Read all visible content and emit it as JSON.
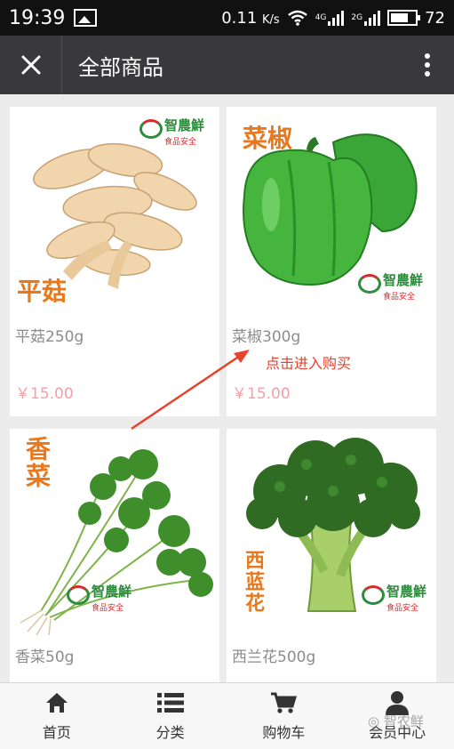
{
  "status_bar": {
    "time": "19:39",
    "speed": "0.11",
    "speed_unit": "K/s",
    "battery": "72",
    "network_a": "4G",
    "network_b": "2G"
  },
  "header": {
    "title": "全部商品"
  },
  "products": [
    {
      "name": "平菇250g",
      "price": "￥15.00",
      "tag": "平菇"
    },
    {
      "name": "菜椒300g",
      "price": "￥15.00",
      "tag": "菜椒"
    },
    {
      "name": "香菜50g",
      "price": "",
      "tag": "香菜"
    },
    {
      "name": "西兰花500g",
      "price": "",
      "tag": "西蓝花"
    }
  ],
  "brand": {
    "name": "智農鮮",
    "slogan": "食品安全"
  },
  "annotation": {
    "hint": "点击进入购买"
  },
  "tabs": [
    {
      "label": "首页",
      "icon": "home-icon"
    },
    {
      "label": "分类",
      "icon": "list-icon"
    },
    {
      "label": "购物车",
      "icon": "cart-icon"
    },
    {
      "label": "会员中心",
      "icon": "user-icon"
    }
  ],
  "watermark": {
    "account": "智农鲜"
  },
  "colors": {
    "header": "#39393d",
    "price": "#f4a0a8",
    "hint": "#e8412c",
    "tag": "#e9781d"
  }
}
